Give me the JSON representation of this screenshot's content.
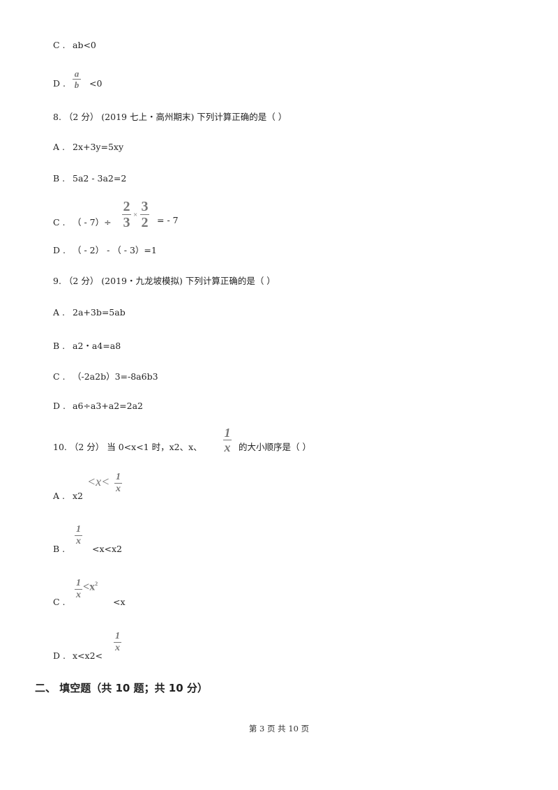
{
  "q7": {
    "options": [
      {
        "label": "C .",
        "text": "ab<0"
      },
      {
        "label": "D .",
        "frac_num": "a",
        "frac_den": "b",
        "text": "<0"
      }
    ]
  },
  "q8": {
    "stem": "8.  （2 分）  (2019 七上・高州期末)  下列计算正确的是（        ）",
    "options": [
      {
        "label": "A .",
        "text": "2x+3y=5xy"
      },
      {
        "label": "B .",
        "text": "5a2 - 3a2=2"
      },
      {
        "label": "C .",
        "text_before": "（ - 7）÷",
        "frac1_num": "2",
        "frac1_den": "3",
        "times": "×",
        "frac2_num": "3",
        "frac2_den": "2",
        "text_after": "= - 7"
      },
      {
        "label": "D .",
        "text": "（ - 2） - （ - 3）=1"
      }
    ]
  },
  "q9": {
    "stem": "9.  （2 分）  (2019・九龙坡模拟)  下列计算正确的是（        ）",
    "options": [
      {
        "label": "A .",
        "text": "2a+3b=5ab"
      },
      {
        "label": "B .",
        "text": "a2・a4=a8"
      },
      {
        "label": "C .",
        "text": "（-2a2b）3=-8a6b3"
      },
      {
        "label": "D .",
        "text": "a6÷a3+a2=2a2"
      }
    ]
  },
  "q10": {
    "stem_before": "10.  （2 分）  当 0<x<1 时，x2、x、",
    "stem_frac_num": "1",
    "stem_frac_den": "x",
    "stem_after": "的大小顺序是（        ）",
    "options": [
      {
        "label": "A .",
        "text": "x2",
        "img_text": "<x<",
        "frac_num": "1",
        "frac_den": "x"
      },
      {
        "label": "B .",
        "frac_num": "1",
        "frac_den": "x",
        "text": "<x<x2"
      },
      {
        "label": "C .",
        "frac_num": "1",
        "frac_den": "x",
        "img_text": "<x",
        "img_sup": "2",
        "text": "<x"
      },
      {
        "label": "D .",
        "text": "x<x2<",
        "frac_num": "1",
        "frac_den": "x"
      }
    ]
  },
  "section": {
    "title": "二、   填空题（共 10 题；共 10 分）"
  },
  "footer": {
    "page_text": "第 3 页 共 10 页"
  }
}
